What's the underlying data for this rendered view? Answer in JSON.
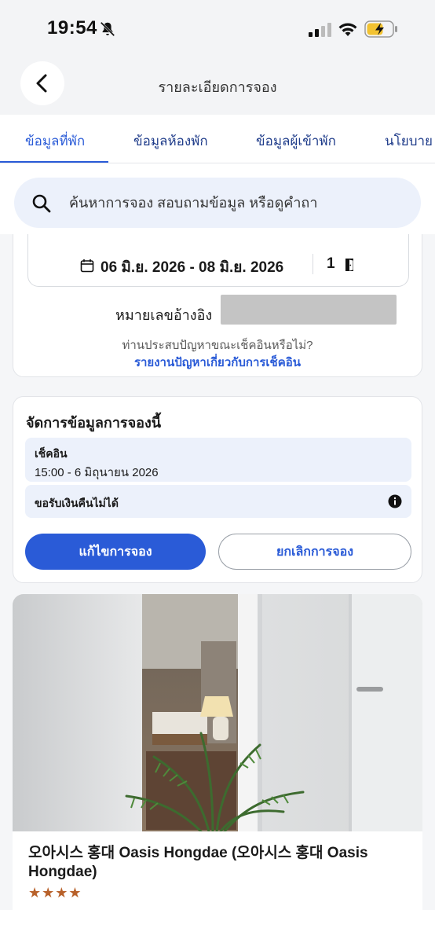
{
  "status_bar": {
    "time": "19:54",
    "icons": [
      "bell-off-icon",
      "cellular-signal-icon",
      "wifi-icon",
      "battery-charging-icon"
    ]
  },
  "header": {
    "title": "รายละเอียดการจอง",
    "back_icon": "chevron-left-icon"
  },
  "tabs": [
    {
      "label": "ข้อมูลที่พัก",
      "active": true
    },
    {
      "label": "ข้อมูลห้องพัก",
      "active": false
    },
    {
      "label": "ข้อมูลผู้เข้าพัก",
      "active": false
    },
    {
      "label": "นโยบาย",
      "active": false
    }
  ],
  "search": {
    "placeholder": "ค้นหาการจอง สอบถามข้อมูล หรือดูคำถา"
  },
  "booking": {
    "dates": "06 มิ.ย. 2026 - 08 มิ.ย. 2026",
    "rooms": "1",
    "reference_label": "หมายเลขอ้างอิง",
    "checkin_question": "ท่านประสบปัญหาขณะเช็คอินหรือไม่?",
    "report_link": "รายงานปัญหาเกี่ยวกับการเช็คอิน"
  },
  "manage": {
    "title": "จัดการข้อมูลการจองนี้",
    "checkin_label": "เช็คอิน",
    "checkin_value": "15:00 - 6 มิถุนายน 2026",
    "refund_label": "ขอรับเงินคืนไม่ได้",
    "edit_button": "แก้ไขการจอง",
    "cancel_button": "ยกเลิกการจอง"
  },
  "hotel": {
    "name": "오아시스 홍대 Oasis Hongdae (오아시스 홍대 Oasis Hongdae)",
    "stars": "★★★★",
    "star_rating": 4
  },
  "colors": {
    "accent": "#2a5bd7",
    "soft_blue": "#ecf1fb",
    "star": "#b8612a"
  }
}
